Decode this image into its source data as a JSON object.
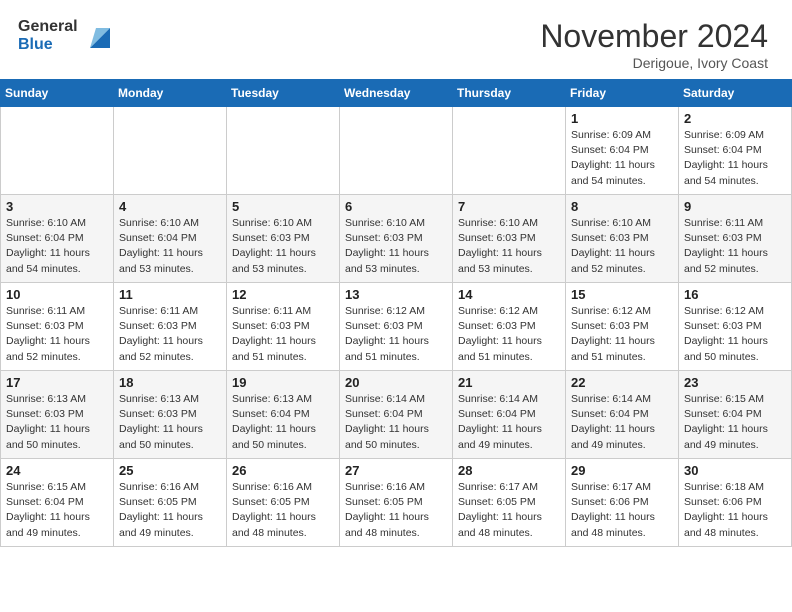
{
  "header": {
    "logo_general": "General",
    "logo_blue": "Blue",
    "month_title": "November 2024",
    "location": "Derigoue, Ivory Coast"
  },
  "days_of_week": [
    "Sunday",
    "Monday",
    "Tuesday",
    "Wednesday",
    "Thursday",
    "Friday",
    "Saturday"
  ],
  "weeks": [
    [
      {
        "day": "",
        "info": ""
      },
      {
        "day": "",
        "info": ""
      },
      {
        "day": "",
        "info": ""
      },
      {
        "day": "",
        "info": ""
      },
      {
        "day": "",
        "info": ""
      },
      {
        "day": "1",
        "info": "Sunrise: 6:09 AM\nSunset: 6:04 PM\nDaylight: 11 hours\nand 54 minutes."
      },
      {
        "day": "2",
        "info": "Sunrise: 6:09 AM\nSunset: 6:04 PM\nDaylight: 11 hours\nand 54 minutes."
      }
    ],
    [
      {
        "day": "3",
        "info": "Sunrise: 6:10 AM\nSunset: 6:04 PM\nDaylight: 11 hours\nand 54 minutes."
      },
      {
        "day": "4",
        "info": "Sunrise: 6:10 AM\nSunset: 6:04 PM\nDaylight: 11 hours\nand 53 minutes."
      },
      {
        "day": "5",
        "info": "Sunrise: 6:10 AM\nSunset: 6:03 PM\nDaylight: 11 hours\nand 53 minutes."
      },
      {
        "day": "6",
        "info": "Sunrise: 6:10 AM\nSunset: 6:03 PM\nDaylight: 11 hours\nand 53 minutes."
      },
      {
        "day": "7",
        "info": "Sunrise: 6:10 AM\nSunset: 6:03 PM\nDaylight: 11 hours\nand 53 minutes."
      },
      {
        "day": "8",
        "info": "Sunrise: 6:10 AM\nSunset: 6:03 PM\nDaylight: 11 hours\nand 52 minutes."
      },
      {
        "day": "9",
        "info": "Sunrise: 6:11 AM\nSunset: 6:03 PM\nDaylight: 11 hours\nand 52 minutes."
      }
    ],
    [
      {
        "day": "10",
        "info": "Sunrise: 6:11 AM\nSunset: 6:03 PM\nDaylight: 11 hours\nand 52 minutes."
      },
      {
        "day": "11",
        "info": "Sunrise: 6:11 AM\nSunset: 6:03 PM\nDaylight: 11 hours\nand 52 minutes."
      },
      {
        "day": "12",
        "info": "Sunrise: 6:11 AM\nSunset: 6:03 PM\nDaylight: 11 hours\nand 51 minutes."
      },
      {
        "day": "13",
        "info": "Sunrise: 6:12 AM\nSunset: 6:03 PM\nDaylight: 11 hours\nand 51 minutes."
      },
      {
        "day": "14",
        "info": "Sunrise: 6:12 AM\nSunset: 6:03 PM\nDaylight: 11 hours\nand 51 minutes."
      },
      {
        "day": "15",
        "info": "Sunrise: 6:12 AM\nSunset: 6:03 PM\nDaylight: 11 hours\nand 51 minutes."
      },
      {
        "day": "16",
        "info": "Sunrise: 6:12 AM\nSunset: 6:03 PM\nDaylight: 11 hours\nand 50 minutes."
      }
    ],
    [
      {
        "day": "17",
        "info": "Sunrise: 6:13 AM\nSunset: 6:03 PM\nDaylight: 11 hours\nand 50 minutes."
      },
      {
        "day": "18",
        "info": "Sunrise: 6:13 AM\nSunset: 6:03 PM\nDaylight: 11 hours\nand 50 minutes."
      },
      {
        "day": "19",
        "info": "Sunrise: 6:13 AM\nSunset: 6:04 PM\nDaylight: 11 hours\nand 50 minutes."
      },
      {
        "day": "20",
        "info": "Sunrise: 6:14 AM\nSunset: 6:04 PM\nDaylight: 11 hours\nand 50 minutes."
      },
      {
        "day": "21",
        "info": "Sunrise: 6:14 AM\nSunset: 6:04 PM\nDaylight: 11 hours\nand 49 minutes."
      },
      {
        "day": "22",
        "info": "Sunrise: 6:14 AM\nSunset: 6:04 PM\nDaylight: 11 hours\nand 49 minutes."
      },
      {
        "day": "23",
        "info": "Sunrise: 6:15 AM\nSunset: 6:04 PM\nDaylight: 11 hours\nand 49 minutes."
      }
    ],
    [
      {
        "day": "24",
        "info": "Sunrise: 6:15 AM\nSunset: 6:04 PM\nDaylight: 11 hours\nand 49 minutes."
      },
      {
        "day": "25",
        "info": "Sunrise: 6:16 AM\nSunset: 6:05 PM\nDaylight: 11 hours\nand 49 minutes."
      },
      {
        "day": "26",
        "info": "Sunrise: 6:16 AM\nSunset: 6:05 PM\nDaylight: 11 hours\nand 48 minutes."
      },
      {
        "day": "27",
        "info": "Sunrise: 6:16 AM\nSunset: 6:05 PM\nDaylight: 11 hours\nand 48 minutes."
      },
      {
        "day": "28",
        "info": "Sunrise: 6:17 AM\nSunset: 6:05 PM\nDaylight: 11 hours\nand 48 minutes."
      },
      {
        "day": "29",
        "info": "Sunrise: 6:17 AM\nSunset: 6:06 PM\nDaylight: 11 hours\nand 48 minutes."
      },
      {
        "day": "30",
        "info": "Sunrise: 6:18 AM\nSunset: 6:06 PM\nDaylight: 11 hours\nand 48 minutes."
      }
    ]
  ]
}
